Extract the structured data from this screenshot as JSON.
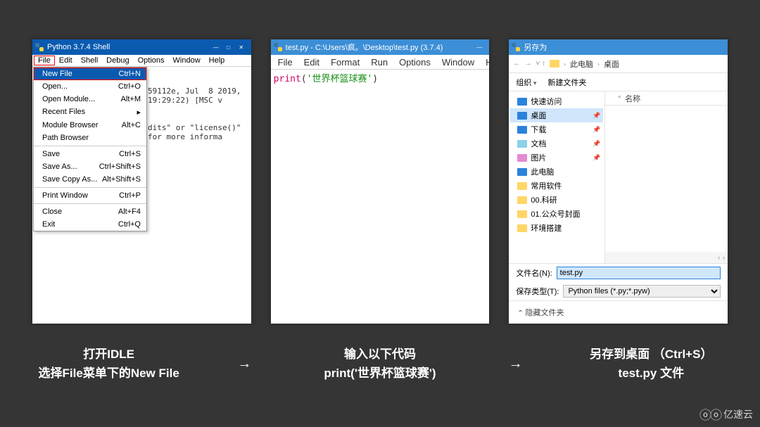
{
  "panel1": {
    "title": "Python 3.7.4 Shell",
    "menus": [
      "File",
      "Edit",
      "Shell",
      "Debug",
      "Options",
      "Window",
      "Help"
    ],
    "bgtext1": "59112e, Jul  8 2019, 19:29:22) [MSC v",
    "bgtext2": "dits\" or \"license()\" for more informa",
    "dropdown": [
      {
        "label": "New File",
        "accel": "Ctrl+N",
        "sel": true
      },
      {
        "label": "Open...",
        "accel": "Ctrl+O"
      },
      {
        "label": "Open Module...",
        "accel": "Alt+M"
      },
      {
        "label": "Recent Files",
        "accel": "▸"
      },
      {
        "label": "Module Browser",
        "accel": "Alt+C"
      },
      {
        "label": "Path Browser",
        "accel": ""
      },
      {
        "sep": true
      },
      {
        "label": "Save",
        "accel": "Ctrl+S"
      },
      {
        "label": "Save As...",
        "accel": "Ctrl+Shift+S"
      },
      {
        "label": "Save Copy As...",
        "accel": "Alt+Shift+S"
      },
      {
        "sep": true
      },
      {
        "label": "Print Window",
        "accel": "Ctrl+P"
      },
      {
        "sep": true
      },
      {
        "label": "Close",
        "accel": "Alt+F4"
      },
      {
        "label": "Exit",
        "accel": "Ctrl+Q"
      }
    ]
  },
  "panel2": {
    "title": "test.py - C:\\Users\\疯。\\Desktop\\test.py (3.7.4)",
    "menus": [
      "File",
      "Edit",
      "Format",
      "Run",
      "Options",
      "Window",
      "Help"
    ],
    "code_print": "print",
    "code_paren1": "(",
    "code_str": "'世界杯篮球赛'",
    "code_paren2": ")"
  },
  "panel3": {
    "title": "另存为",
    "breadcrumb": {
      "a": "此电脑",
      "b": "桌面"
    },
    "organize": "组织",
    "newfolder": "新建文件夹",
    "listheader": "名称",
    "tree": [
      {
        "icon": "star",
        "label": "快速访问",
        "pin": false
      },
      {
        "icon": "desk",
        "label": "桌面",
        "pin": true,
        "selected": true
      },
      {
        "icon": "down",
        "label": "下载",
        "pin": true
      },
      {
        "icon": "doc",
        "label": "文档",
        "pin": true
      },
      {
        "icon": "pic",
        "label": "图片",
        "pin": true
      },
      {
        "icon": "pc",
        "label": "此电脑"
      },
      {
        "icon": "fold",
        "label": "常用软件"
      },
      {
        "icon": "fold",
        "label": "00.科研"
      },
      {
        "icon": "fold",
        "label": "01.公众号封面"
      },
      {
        "icon": "fold",
        "label": "环境搭建"
      }
    ],
    "fn_label": "文件名(N):",
    "fn_value": "test.py",
    "ft_label": "保存类型(T):",
    "ft_value": "Python files (*.py;*.pyw)",
    "hidefolders": "隐藏文件夹"
  },
  "captions": {
    "c1a": "打开IDLE",
    "c1b": "选择File菜单下的New File",
    "c2a": "输入以下代码",
    "c2b": "print('世界杯篮球赛')",
    "c3a": "另存到桌面 （Ctrl+S）",
    "c3b": "test.py 文件"
  },
  "watermark": "亿速云"
}
